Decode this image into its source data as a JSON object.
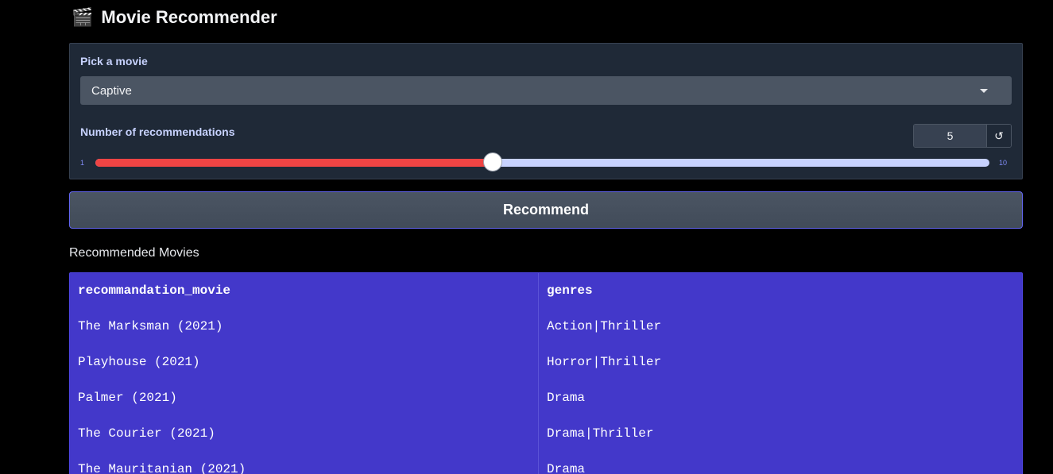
{
  "app": {
    "title": "Movie Recommender",
    "title_icon": "clapperboard-icon"
  },
  "form": {
    "movie_label": "Pick a movie",
    "movie_value": "Captive",
    "count_label": "Number of recommendations",
    "count_value": "5",
    "slider_min": "1",
    "slider_max": "10",
    "slider_value": 5,
    "reset_icon": "reset-icon"
  },
  "actions": {
    "recommend_label": "Recommend"
  },
  "results": {
    "label": "Recommended Movies",
    "columns": [
      "recommandation_movie",
      "genres"
    ],
    "rows": [
      [
        "The Marksman (2021)",
        "Action|Thriller"
      ],
      [
        "Playhouse (2021)",
        "Horror|Thriller"
      ],
      [
        "Palmer (2021)",
        "Drama"
      ],
      [
        "The Courier (2021)",
        "Drama|Thriller"
      ],
      [
        "The Mauritanian (2021)",
        "Drama"
      ]
    ]
  },
  "colors": {
    "background": "#000000",
    "card": "#1f2937",
    "slider_fill": "#ef4444",
    "slider_track": "#c7d2fe",
    "table_bg": "#4338ca"
  }
}
